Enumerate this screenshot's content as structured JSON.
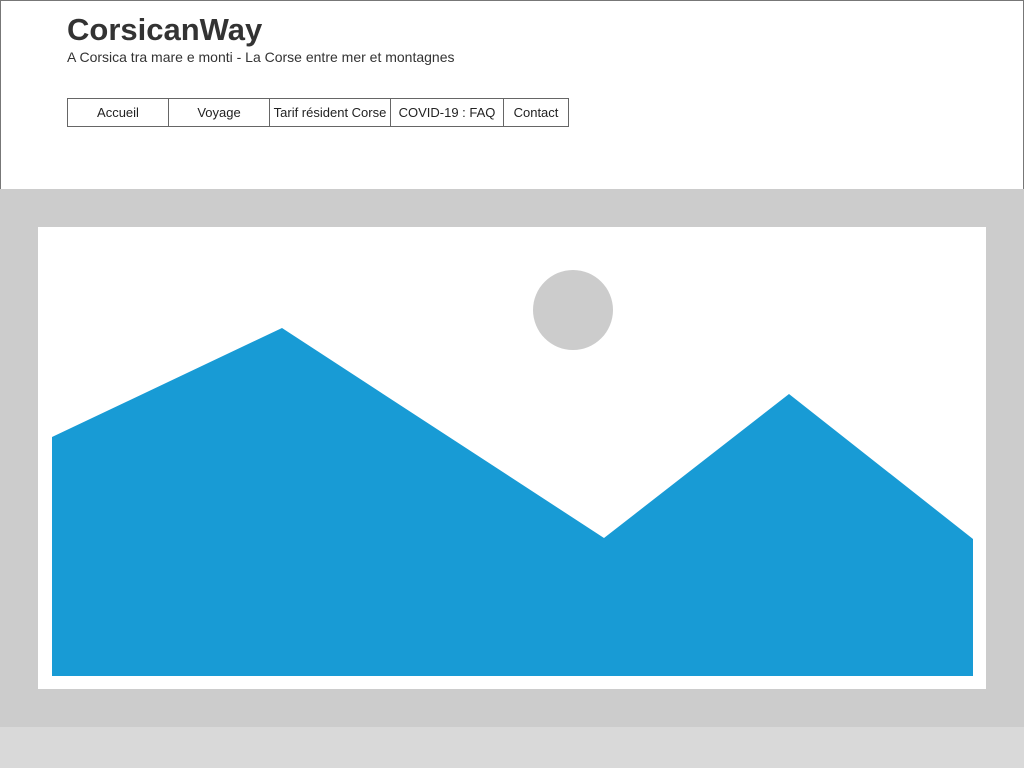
{
  "site": {
    "title": "CorsicanWay",
    "tagline": "A Corsica tra mare e monti - La Corse entre mer et montagnes"
  },
  "nav": {
    "items": [
      {
        "label": "Accueil"
      },
      {
        "label": "Voyage"
      },
      {
        "label": "Tarif résident Corse"
      },
      {
        "label": "COVID-19 : FAQ"
      },
      {
        "label": "Contact"
      }
    ]
  },
  "hero": {
    "icon": "image-placeholder-icon",
    "mountain_color": "#189bd5",
    "sun_color": "#cccccc",
    "frame_color": "#ffffff",
    "background_color": "#cccccc"
  }
}
